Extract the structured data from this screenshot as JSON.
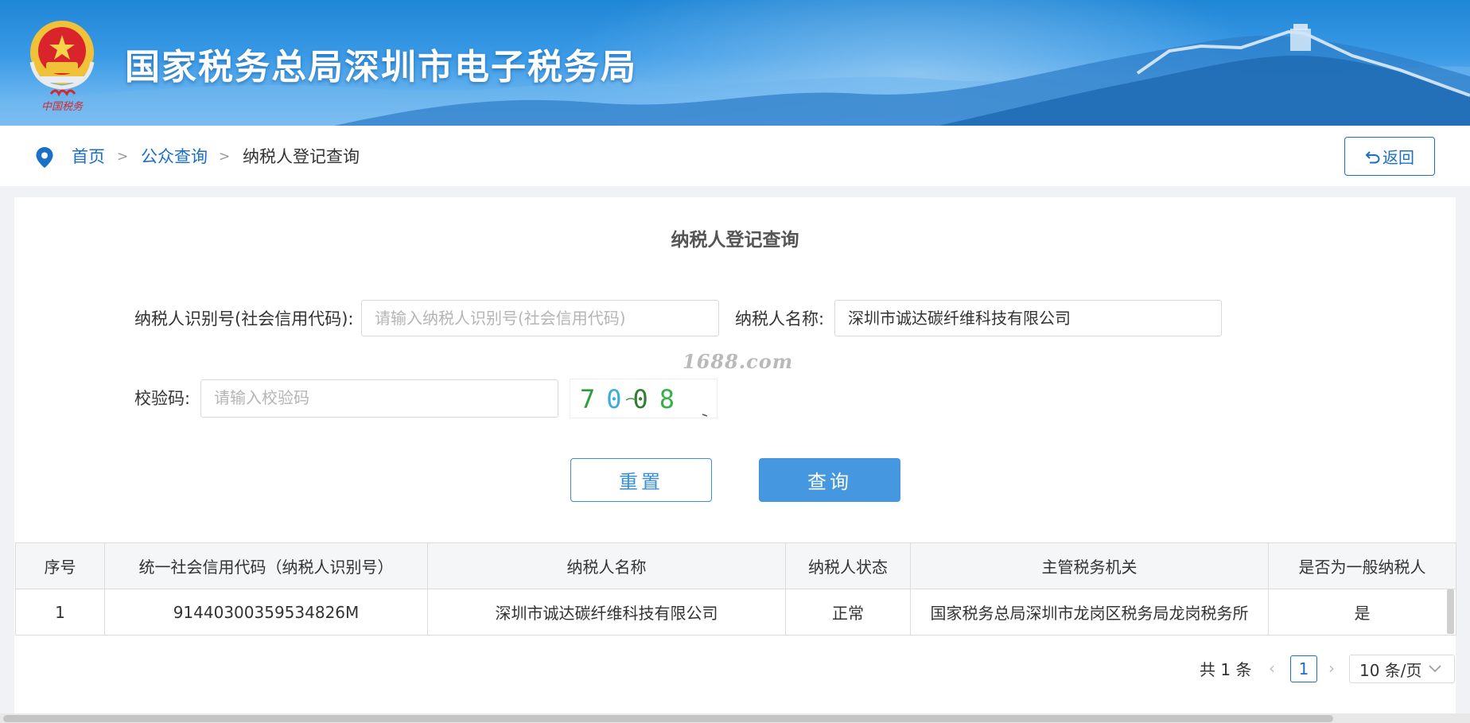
{
  "header": {
    "site_title": "国家税务总局深圳市电子税务局",
    "emblem_caption": "中国税务"
  },
  "breadcrumb": {
    "home": "首页",
    "separator": ">",
    "public_query": "公众查询",
    "current": "纳税人登记查询"
  },
  "toolbar": {
    "back_label": "返回"
  },
  "form": {
    "title": "纳税人登记查询",
    "taxpayer_id_label": "纳税人识别号(社会信用代码):",
    "taxpayer_id_placeholder": "请输入纳税人识别号(社会信用代码)",
    "taxpayer_id_value": "",
    "taxpayer_name_label": "纳税人名称:",
    "taxpayer_name_value": "深圳市诚达碳纤维科技有限公司",
    "captcha_label": "校验码:",
    "captcha_placeholder": "请输入校验码",
    "captcha_text": "7008",
    "watermark": "1688.com",
    "reset_label": "重置",
    "query_label": "查询"
  },
  "table": {
    "headers": [
      "序号",
      "统一社会信用代码（纳税人识别号）",
      "纳税人名称",
      "纳税人状态",
      "主管税务机关",
      "是否为一般纳税人"
    ],
    "rows": [
      [
        "1",
        "91440300359534826M",
        "深圳市诚达碳纤维科技有限公司",
        "正常",
        "国家税务总局深圳市龙岗区税务局龙岗税务所",
        "是"
      ]
    ]
  },
  "pager": {
    "total": "共 1 条",
    "current_page": "1",
    "page_size": "10 条/页"
  },
  "colors": {
    "brand_blue": "#1a6fc7",
    "button_blue": "#4598e0",
    "banner_blue": "#2a8fe0"
  },
  "icons": {
    "location": "location-pin-icon",
    "back": "return-arrow-icon",
    "prev": "chevron-left-icon",
    "next": "chevron-right-icon",
    "dropdown": "chevron-down-icon"
  }
}
